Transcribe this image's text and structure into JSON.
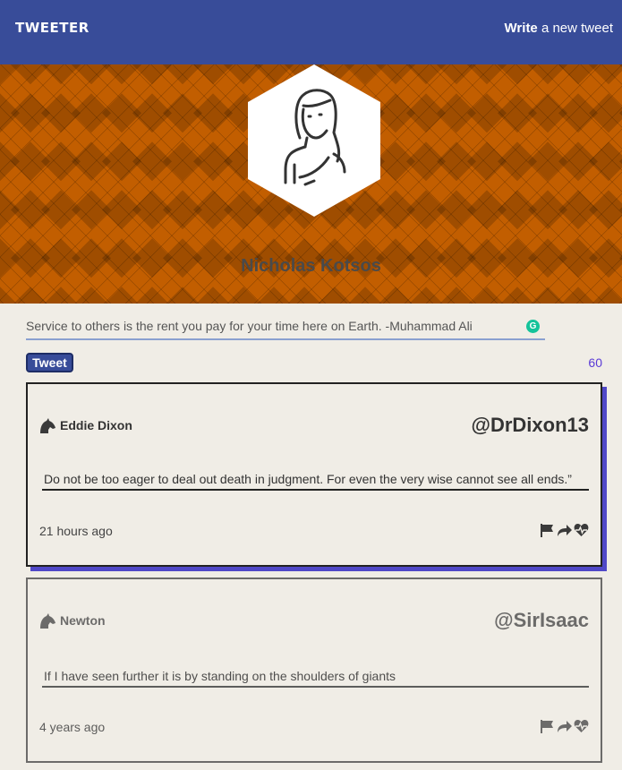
{
  "nav": {
    "brand": "TWEETER",
    "compose_bold": "Write",
    "compose_rest": " a new tweet"
  },
  "profile": {
    "name": "Nicholas Kotsos",
    "avatar_icon": "user-avatar-icon",
    "banner_color": "#c25e00"
  },
  "compose": {
    "value": "Service to others is the rent you pay for your time here on Earth. -Muhammad Ali",
    "button_label": "Tweet",
    "counter": "60"
  },
  "tweets": [
    {
      "name": "Eddie Dixon",
      "handle": "@DrDixon13",
      "content": "Do not be too eager to deal out death in judgment. For even the very wise cannot see all ends.”",
      "time": "21 hours ago"
    },
    {
      "name": "Newton",
      "handle": "@SirIsaac",
      "content": "If I have seen further it is by standing on the shoulders of giants",
      "time": "4 years ago"
    }
  ],
  "icons": {
    "flag": "flag-icon",
    "retweet": "retweet-icon",
    "like": "heart-icon",
    "author": "horse-avatar-icon"
  },
  "colors": {
    "nav": "#384c99",
    "accent_shadow": "#5048c8",
    "counter": "#5a3ad6"
  }
}
